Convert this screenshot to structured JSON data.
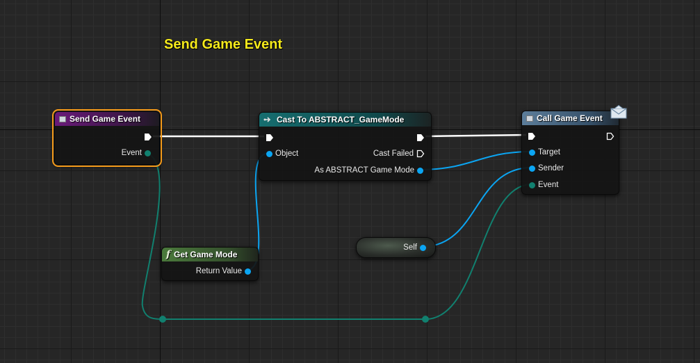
{
  "comment": {
    "title": "Send Game Event"
  },
  "nodes": {
    "send_event": {
      "title": "Send Game Event",
      "header_color": "#6a1a7a",
      "pins": {
        "event": "Event"
      }
    },
    "cast": {
      "title": "Cast To ABSTRACT_GameMode",
      "header_color": "#166e70",
      "pins": {
        "object": "Object",
        "cast_failed": "Cast Failed",
        "as_mode": "As ABSTRACT Game Mode"
      }
    },
    "call_event": {
      "title": "Call Game Event",
      "header_color": "#3f5d78",
      "pins": {
        "target": "Target",
        "sender": "Sender",
        "event": "Event"
      }
    },
    "get_game_mode": {
      "title": "Get Game Mode",
      "header_color": "#4b7a3c",
      "pins": {
        "return_value": "Return Value"
      }
    },
    "self": {
      "label": "Self"
    }
  },
  "colors": {
    "object_pin": "#0ba5f2",
    "struct_pin": "#11806f",
    "exec_wire": "#ffffff",
    "selection": "#f49a1a",
    "comment_text": "#f5ea1c"
  },
  "icons": {
    "event_node": "event-doc-icon",
    "cast_node": "cast-arrow-icon",
    "function_node": "function-f-icon",
    "message": "envelope-icon"
  }
}
